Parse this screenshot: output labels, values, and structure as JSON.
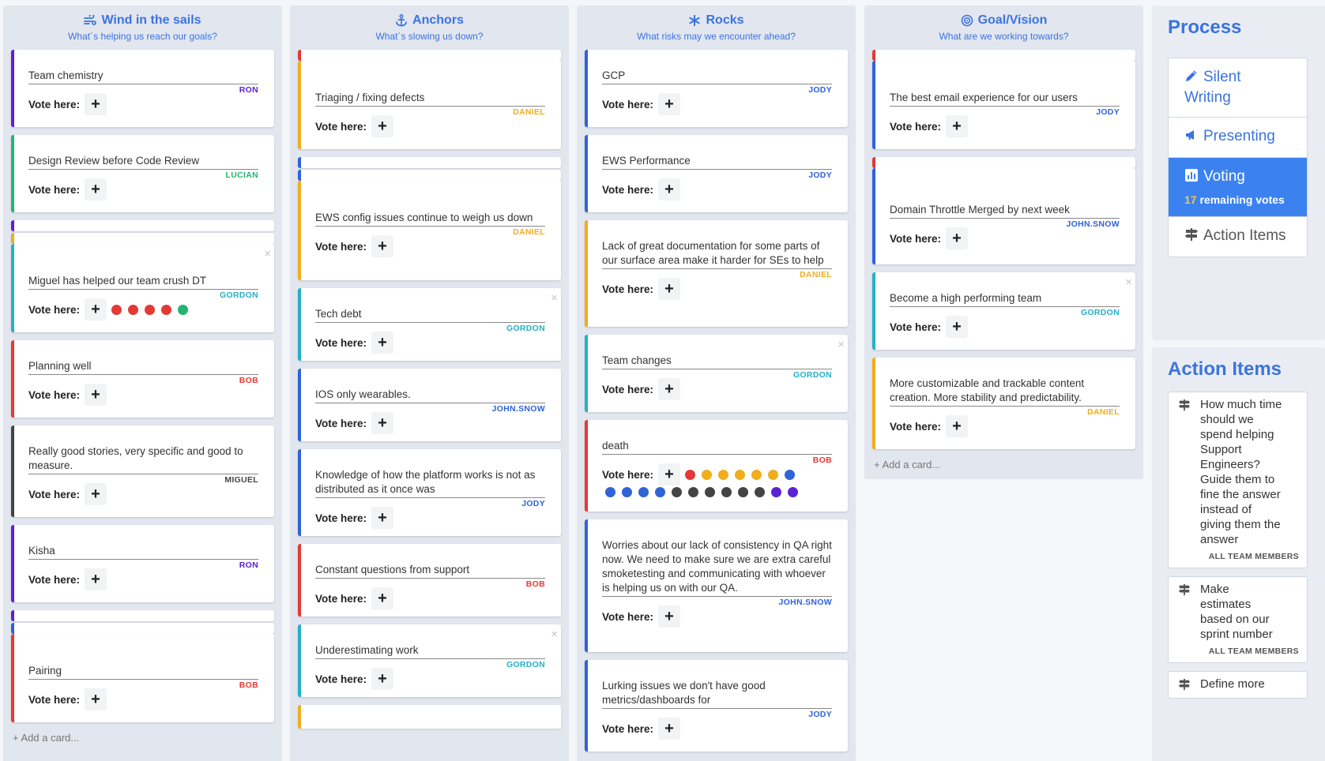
{
  "columns": [
    {
      "title": "Wind in the sails",
      "subtitle": "What´s helping us reach our goals?",
      "icon": "wind-icon",
      "add_card": "Add a card...",
      "cards": [
        {
          "text": "Team chemistry",
          "author": "RON"
        },
        {
          "text": "Design Review before Code Review",
          "author": "LUCIAN"
        },
        {
          "text": "Miguel has helped our team crush DT",
          "author": "GORDON"
        },
        {
          "text": "Planning well",
          "author": "BOB"
        },
        {
          "text": "Really good stories, very specific and good to measure.",
          "author": "MIGUEL"
        },
        {
          "text": "Kisha",
          "author": "RON"
        },
        {
          "text": "Pairing",
          "author": "BOB"
        }
      ]
    },
    {
      "title": "Anchors",
      "subtitle": "What´s slowing us down?",
      "icon": "anchor-icon",
      "cards": [
        {
          "text": "Triaging / fixing defects",
          "author": "DANIEL"
        },
        {
          "text": "EWS config issues continue to weigh us down",
          "author": "DANIEL"
        },
        {
          "text": "Tech debt",
          "author": "GORDON"
        },
        {
          "text": "IOS only wearables.",
          "author": "JOHN.SNOW"
        },
        {
          "text": "Knowledge of how the platform works is not as distributed as it once was",
          "author": "JODY"
        },
        {
          "text": "Constant questions from support",
          "author": "BOB"
        },
        {
          "text": "Underestimating work",
          "author": "GORDON"
        }
      ]
    },
    {
      "title": "Rocks",
      "subtitle": "What risks may we encounter ahead?",
      "icon": "asterisk-icon",
      "cards": [
        {
          "text": "GCP",
          "author": "JODY"
        },
        {
          "text": "EWS Performance",
          "author": "JODY"
        },
        {
          "text": "Lack of great documentation for some parts of our surface area make it harder for SEs to help",
          "author": "DANIEL"
        },
        {
          "text": "Team changes",
          "author": "GORDON"
        },
        {
          "text": "death",
          "author": "BOB"
        },
        {
          "text": "Worries about our lack of consistency in QA right now. We need to make sure we are extra careful smoketesting and communicating with whoever is helping us on with our QA.",
          "author": "JOHN.SNOW"
        },
        {
          "text": "Lurking issues we don't have good metrics/dashboards for",
          "author": "JODY"
        }
      ]
    },
    {
      "title": "Goal/Vision",
      "subtitle": "What are we working towards?",
      "icon": "target-icon",
      "add_card": "Add a card...",
      "cards": [
        {
          "text": "The best email experience for our users",
          "author": "JODY"
        },
        {
          "text": "Domain Throttle Merged by next week",
          "author": "JOHN.SNOW"
        },
        {
          "text": "Become a high performing team",
          "author": "GORDON"
        },
        {
          "text": "More customizable and trackable content creation. More stability and predictability.",
          "author": "DANIEL"
        }
      ]
    }
  ],
  "vote_label": "Vote here:",
  "vote_plus": "+",
  "close_glyph": "×",
  "colors": {
    "RON": "#5b21d6",
    "LUCIAN": "#22b573",
    "GORDON": "#26b0c4",
    "BOB": "#e53935",
    "MIGUEL": "#444444",
    "DANIEL": "#f0ad1e",
    "JOHN.SNOW": "#2f63d8",
    "JODY": "#2f63d8",
    "accent": "#3b73e0",
    "active": "#3b82f0"
  },
  "sidebar": {
    "process_title": "Process",
    "process_items": [
      {
        "label": "Silent Writing",
        "icon": "pencil-icon"
      },
      {
        "label": "Presenting",
        "icon": "megaphone-icon"
      },
      {
        "label": "Voting",
        "icon": "chart-icon",
        "remaining_count": "17",
        "remaining_text": "remaining votes"
      },
      {
        "label": "Action Items",
        "icon": "signpost-icon"
      }
    ],
    "action_title": "Action Items",
    "action_items": [
      {
        "text": "How much time should we spend helping Support Engineers? Guide them to fine the answer instead of giving them the answer",
        "who": "ALL TEAM MEMBERS"
      },
      {
        "text": "Make estimates based on our sprint number",
        "who": "ALL TEAM MEMBERS"
      },
      {
        "text": "Define more",
        "who": ""
      }
    ]
  }
}
